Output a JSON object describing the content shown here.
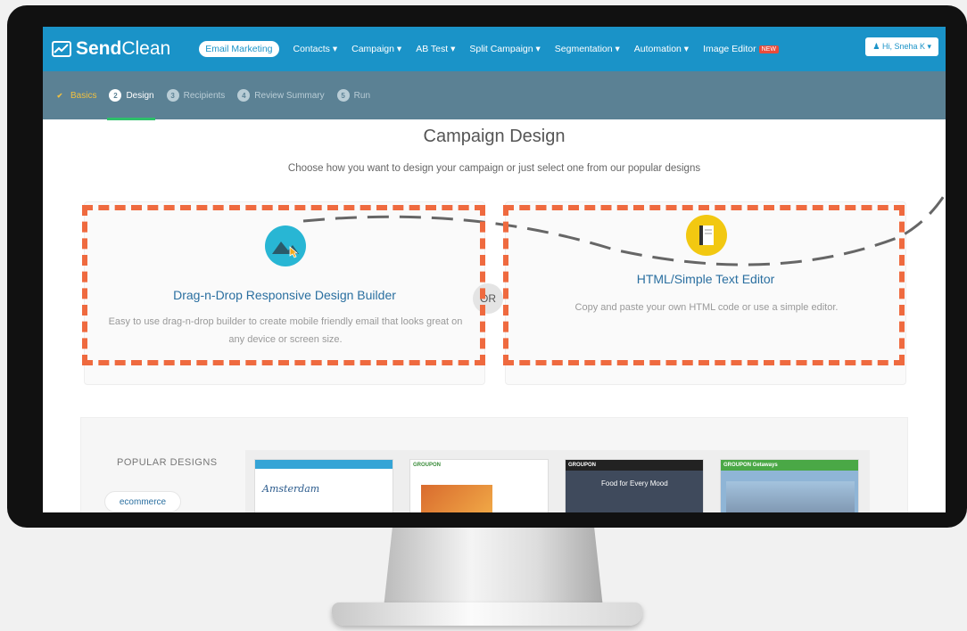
{
  "app": {
    "brand_prefix": "Send",
    "brand_suffix": "Clean"
  },
  "nav": {
    "items": [
      "Email Marketing",
      "Contacts ▾",
      "Campaign ▾",
      "AB Test ▾",
      "Split Campaign ▾",
      "Segmentation ▾",
      "Automation ▾",
      "Image Editor"
    ],
    "new_badge": "NEW",
    "user": "Hi, Sneha K ▾"
  },
  "steps": [
    {
      "num": "✔",
      "label": "Basics"
    },
    {
      "num": "2",
      "label": "Design"
    },
    {
      "num": "3",
      "label": "Recipients"
    },
    {
      "num": "4",
      "label": "Review Summary"
    },
    {
      "num": "5",
      "label": "Run"
    }
  ],
  "page": {
    "title": "Campaign Design",
    "subtitle": "Choose how you want to design your campaign or just select one from our popular designs",
    "or": "OR"
  },
  "options": [
    {
      "title": "Drag-n-Drop Responsive Design Builder",
      "desc": "Easy to use drag-n-drop builder to create mobile friendly email that looks great on any device or screen size."
    },
    {
      "title": "HTML/Simple Text Editor",
      "desc": "Copy and paste your own HTML code or use a simple editor."
    }
  ],
  "popular": {
    "label": "POPULAR DESIGNS",
    "tag": "ecommerce",
    "thumbs": [
      {
        "label": "Amsterdam"
      },
      {
        "label": "GROUPON"
      },
      {
        "label": "GROUPON",
        "sub": "Food for Every Mood"
      },
      {
        "label": "GROUPON Getaways"
      }
    ]
  },
  "colors": {
    "nav": "#1a93c8",
    "steps": "#5b8194",
    "accent": "#ef6a3f",
    "progress": "#2ec06a"
  }
}
